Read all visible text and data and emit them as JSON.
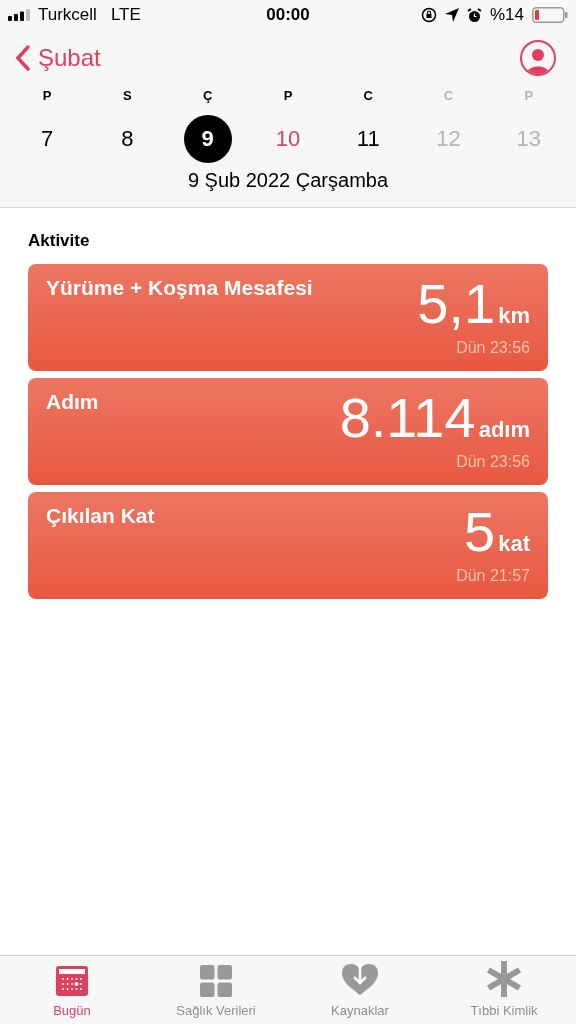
{
  "status_bar": {
    "carrier": "Turkcell",
    "network": "LTE",
    "time": "00:00",
    "battery": "%14"
  },
  "nav": {
    "back": "Şubat"
  },
  "week": [
    {
      "letter": "P",
      "day": "7",
      "kind": "past",
      "selected": false
    },
    {
      "letter": "S",
      "day": "8",
      "kind": "past",
      "selected": false
    },
    {
      "letter": "Ç",
      "day": "9",
      "kind": "past",
      "selected": true
    },
    {
      "letter": "P",
      "day": "10",
      "kind": "today",
      "selected": false
    },
    {
      "letter": "C",
      "day": "11",
      "kind": "past",
      "selected": false
    },
    {
      "letter": "C",
      "day": "12",
      "kind": "future",
      "selected": false
    },
    {
      "letter": "P",
      "day": "13",
      "kind": "future",
      "selected": false
    }
  ],
  "date_label": "9 Şub 2022 Çarşamba",
  "section_title": "Aktivite",
  "cards": [
    {
      "title": "Yürüme + Koşma Mesafesi",
      "value": "5,1",
      "unit": "km",
      "time": "Dün 23:56"
    },
    {
      "title": "Adım",
      "value": "8.114",
      "unit": "adım",
      "time": "Dün 23:56"
    },
    {
      "title": "Çıkılan Kat",
      "value": "5",
      "unit": "kat",
      "time": "Dün 21:57"
    }
  ],
  "tabs": [
    {
      "label": "Bugün",
      "kind": "today",
      "selected": true
    },
    {
      "label": "Sağlık Verileri",
      "kind": "data",
      "selected": false
    },
    {
      "label": "Kaynaklar",
      "kind": "sources",
      "selected": false
    },
    {
      "label": "Tıbbi Kimlik",
      "kind": "medical",
      "selected": false
    }
  ]
}
